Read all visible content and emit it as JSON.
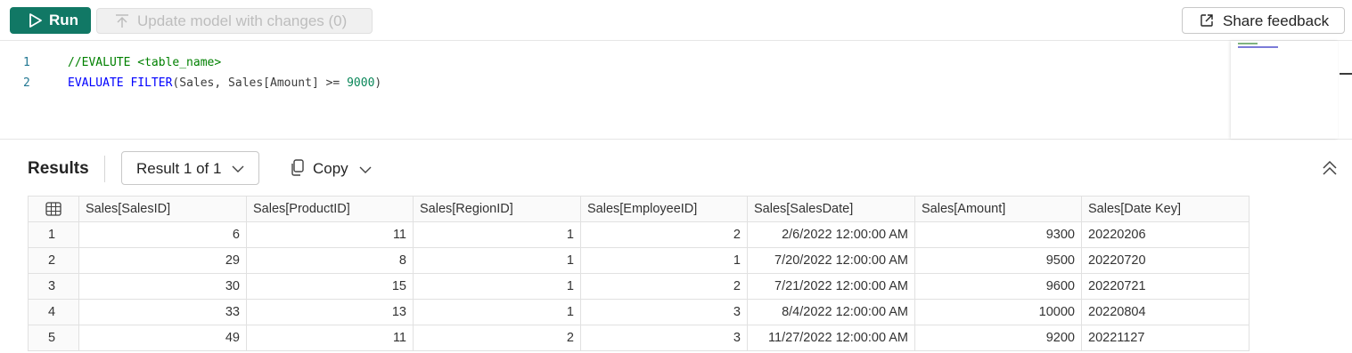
{
  "toolbar": {
    "run_label": "Run",
    "update_label": "Update model with changes (0)",
    "share_label": "Share feedback"
  },
  "editor": {
    "lines": [
      {
        "number": "1",
        "text": "//EVALUTE <table_name>"
      },
      {
        "number": "2",
        "text": "EVALUATE FILTER(Sales, Sales[Amount] >= 9000)"
      }
    ]
  },
  "results": {
    "title": "Results",
    "result_selector": "Result 1 of 1",
    "copy_label": "Copy"
  },
  "table": {
    "columns": [
      "Sales[SalesID]",
      "Sales[ProductID]",
      "Sales[RegionID]",
      "Sales[EmployeeID]",
      "Sales[SalesDate]",
      "Sales[Amount]",
      "Sales[Date Key]"
    ],
    "rows": [
      {
        "index": "1",
        "cells": [
          "6",
          "11",
          "1",
          "2",
          "2/6/2022 12:00:00 AM",
          "9300",
          "20220206"
        ]
      },
      {
        "index": "2",
        "cells": [
          "29",
          "8",
          "1",
          "1",
          "7/20/2022 12:00:00 AM",
          "9500",
          "20220720"
        ]
      },
      {
        "index": "3",
        "cells": [
          "30",
          "15",
          "1",
          "2",
          "7/21/2022 12:00:00 AM",
          "9600",
          "20220721"
        ]
      },
      {
        "index": "4",
        "cells": [
          "33",
          "13",
          "1",
          "3",
          "8/4/2022 12:00:00 AM",
          "10000",
          "20220804"
        ]
      },
      {
        "index": "5",
        "cells": [
          "49",
          "11",
          "2",
          "3",
          "11/27/2022 12:00:00 AM",
          "9200",
          "20221127"
        ]
      }
    ]
  },
  "colors": {
    "run_button": "#117865",
    "comment": "#008000",
    "keyword": "#0000ff",
    "number": "#098658"
  }
}
